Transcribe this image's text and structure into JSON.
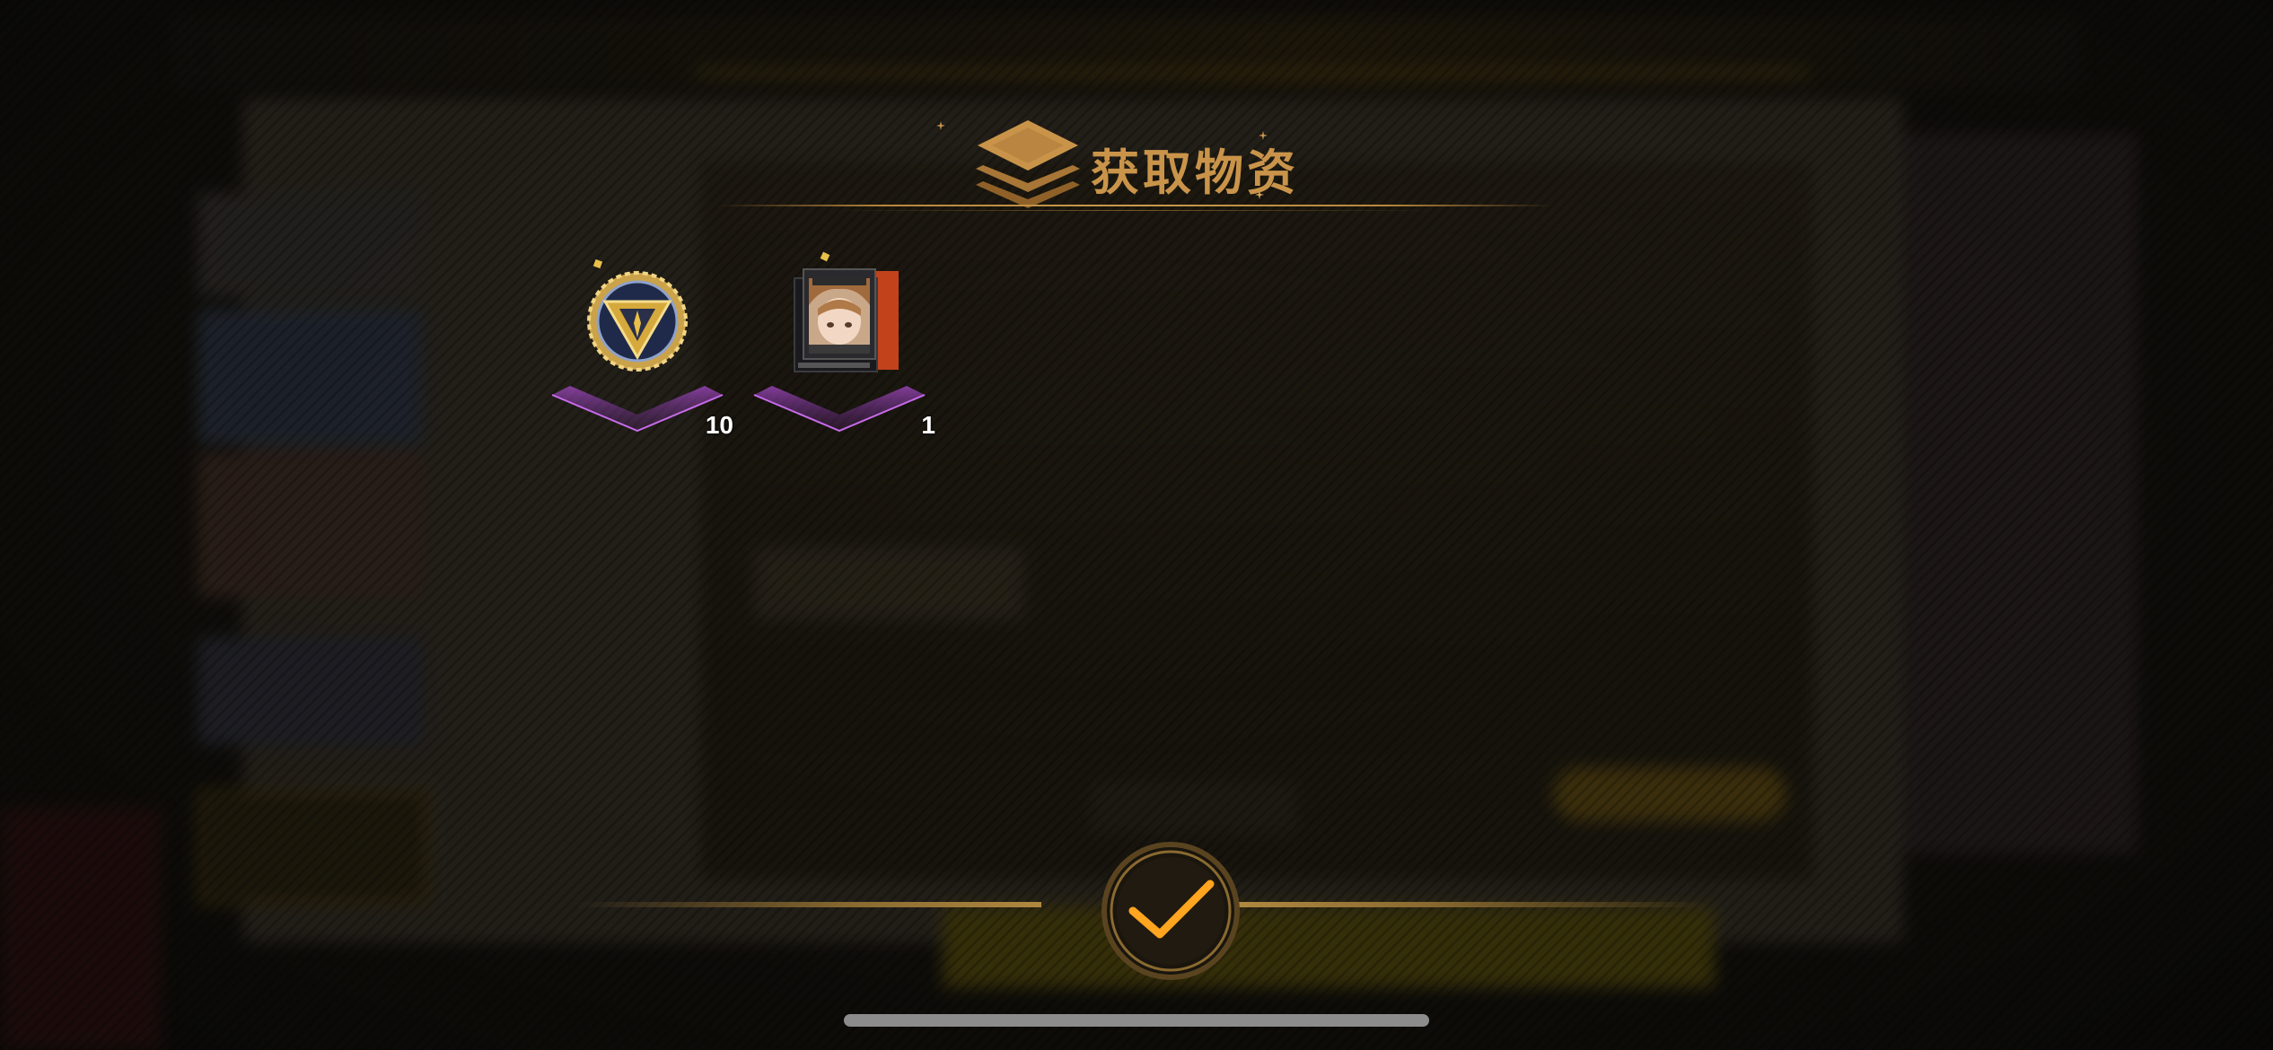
{
  "dialog": {
    "title": "获取物资",
    "confirm_icon": "checkmark-icon"
  },
  "rewards": [
    {
      "name": "badge-token",
      "icon": "triangle-emblem-badge-icon",
      "quantity": "10"
    },
    {
      "name": "character-profile-card",
      "icon": "character-portrait-card-icon",
      "quantity": "1"
    }
  ],
  "colors": {
    "title_gold": "#c9944a",
    "rarity_purple": "#b14fd6",
    "confirm_orange": "#ffa51f"
  }
}
